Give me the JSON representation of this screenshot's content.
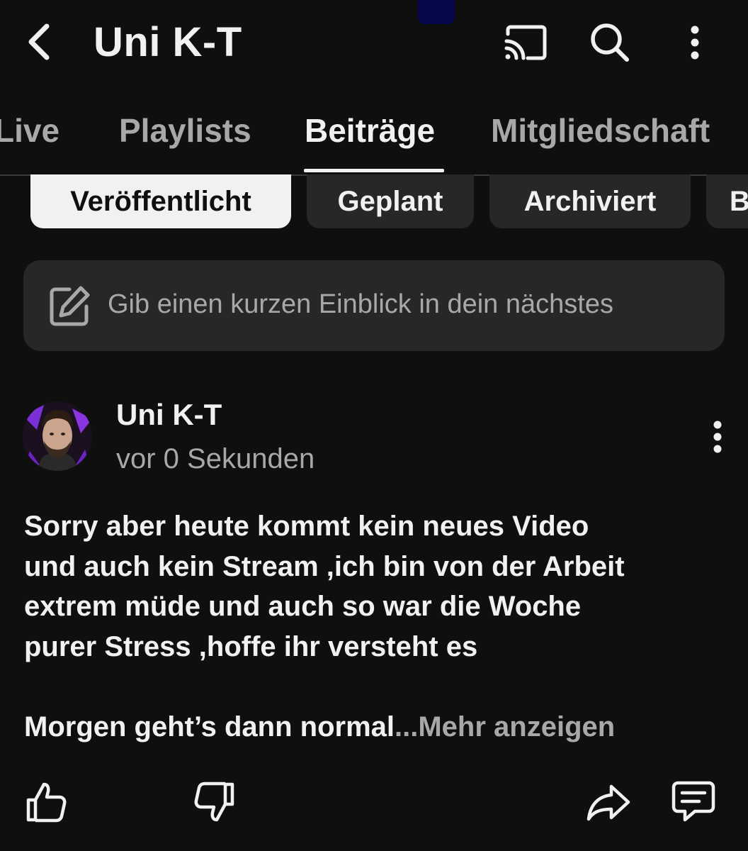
{
  "header": {
    "channel_title": "Uni K-T",
    "icons": {
      "back": "chevron-left-icon",
      "cast": "cast-icon",
      "search": "search-icon",
      "more": "more-vertical-icon"
    }
  },
  "tabs": [
    {
      "label": "Live",
      "active": false
    },
    {
      "label": "Playlists",
      "active": false
    },
    {
      "label": "Beiträge",
      "active": true
    },
    {
      "label": "Mitgliedschaft",
      "active": false
    }
  ],
  "filter_chips": [
    {
      "label": "Veröffentlicht",
      "selected": true
    },
    {
      "label": "Geplant",
      "selected": false
    },
    {
      "label": "Archiviert",
      "selected": false
    },
    {
      "label": "B",
      "selected": false
    }
  ],
  "composer": {
    "placeholder": "Gib einen kurzen Einblick in dein nächstes",
    "icon": "edit-icon"
  },
  "post": {
    "author": "Uni K-T",
    "timestamp": "vor 0 Sekunden",
    "body_lines": [
      "Sorry aber heute kommt kein neues Video",
      "und auch kein Stream ,ich bin von der Arbeit",
      "extrem müde und auch so war die Woche",
      "purer Stress ,hoffe ihr versteht es"
    ],
    "body_last_line": "Morgen geht’s dann normal",
    "ellipsis": "...",
    "show_more": "Mehr anzeigen",
    "actions": {
      "like": "thumbs-up-icon",
      "dislike": "thumbs-down-icon",
      "share": "share-icon",
      "comment": "comment-icon"
    }
  },
  "colors": {
    "background": "#0f0f0f",
    "surface": "#272727",
    "text_primary": "#f1f1f1",
    "text_secondary": "#a8a8a8",
    "avatar_accent": "#7b2fd6"
  }
}
